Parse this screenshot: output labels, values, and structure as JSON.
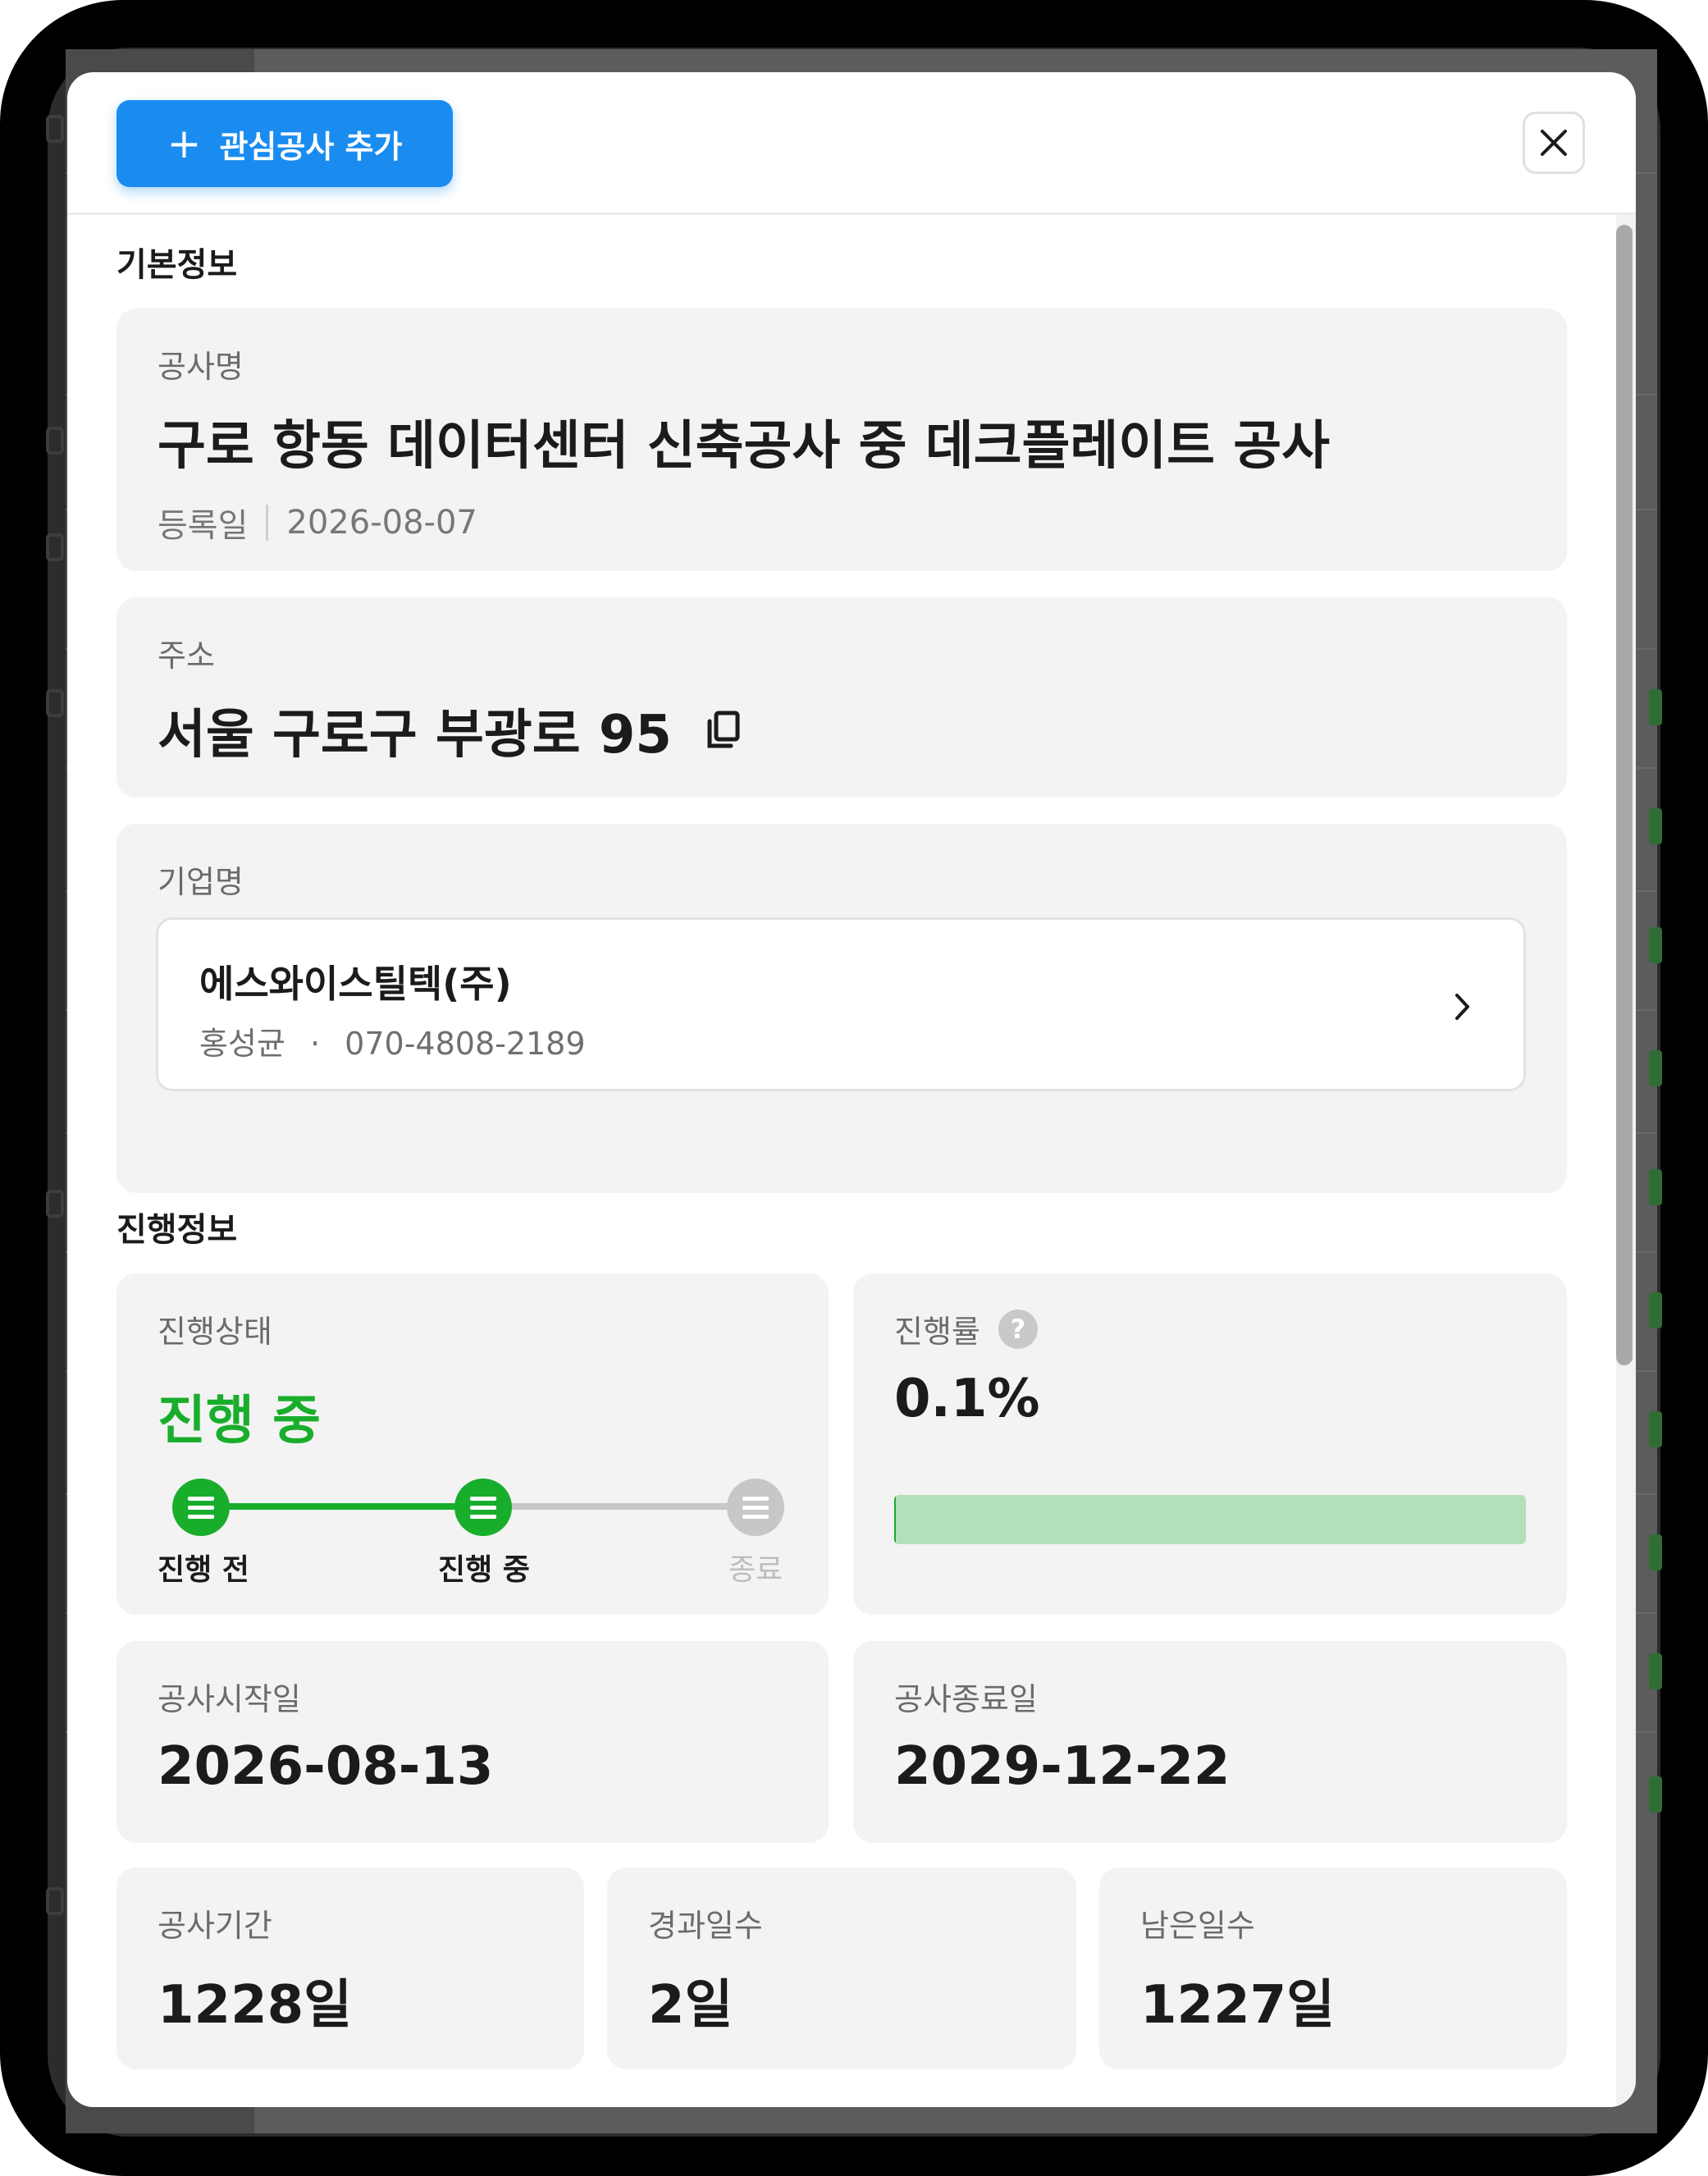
{
  "header": {
    "add_button_icon": "plus-icon",
    "add_button_label": "관심공사 추가",
    "close_icon": "close-icon"
  },
  "basic_info": {
    "section_title": "기본정보",
    "project": {
      "label": "공사명",
      "name": "구로 항동 데이터센터 신축공사 중 데크플레이트 공사",
      "registered_label": "등록일",
      "registered_date": "2026-08-07"
    },
    "address": {
      "label": "주소",
      "value": "서울 구로구 부광로 95",
      "copy_icon": "copy-icon"
    },
    "company": {
      "label": "기업명",
      "name": "에스와이스틸텍(주)",
      "contact_name": "홍성균",
      "phone": "070-4808-2189",
      "separator": "·",
      "chevron_icon": "chevron-right-icon"
    }
  },
  "progress_info": {
    "section_title": "진행정보",
    "status": {
      "label": "진행상태",
      "value": "진행 중",
      "steps": [
        {
          "label": "진행 전",
          "state": "done"
        },
        {
          "label": "진행 중",
          "state": "current"
        },
        {
          "label": "종료",
          "state": "pending"
        }
      ]
    },
    "rate": {
      "label": "진행률",
      "help_icon": "help-icon",
      "help_glyph": "?",
      "value": "0.1%",
      "fraction": 0.001
    },
    "start": {
      "label": "공사시작일",
      "value": "2026-08-13"
    },
    "end": {
      "label": "공사종료일",
      "value": "2029-12-22"
    },
    "duration": {
      "label": "공사기간",
      "value": "1228일"
    },
    "elapsed": {
      "label": "경과일수",
      "value": "2일"
    },
    "remaining": {
      "label": "남은일수",
      "value": "1227일"
    }
  },
  "colors": {
    "accent_blue": "#1a8cf0",
    "status_green": "#19ad2c",
    "progress_track": "#b2e0b9",
    "card_bg": "#f3f3f3"
  }
}
